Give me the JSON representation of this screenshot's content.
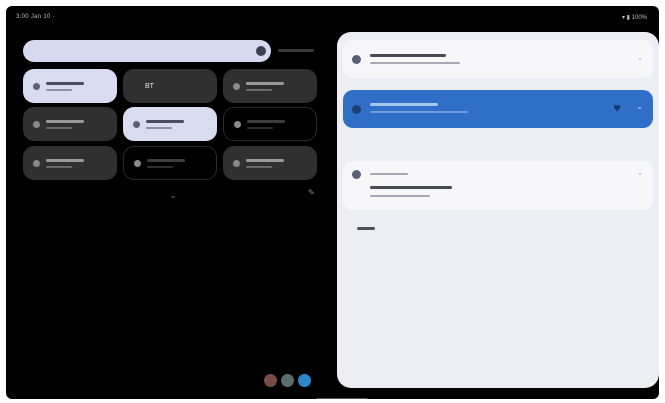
{
  "status_bar": {
    "left_text": "3:00 Jan 10 ·",
    "right_text": "▾ ▮ 100%"
  },
  "quick_settings": {
    "tiles": [
      {
        "label": "",
        "active": true
      },
      {
        "label": "BT",
        "active": false
      },
      {
        "label": "",
        "active": false
      },
      {
        "label": "",
        "active": false
      },
      {
        "label": "",
        "active": true
      },
      {
        "label": "",
        "active": false
      },
      {
        "label": "",
        "active": false
      },
      {
        "label": "",
        "active": false
      },
      {
        "label": "",
        "active": false
      }
    ]
  },
  "notifications": {
    "silent_label": "",
    "manage_label": ""
  },
  "colors": {
    "tile_active": "#d9dcf0",
    "tile_inactive": "#303030",
    "accent_blue": "#2f6fc7",
    "panel_bg": "#edeef4"
  },
  "icons": [
    "settings-dots-icon",
    "edit-pencil-icon",
    "heart-icon",
    "chevron-down-icon"
  ]
}
